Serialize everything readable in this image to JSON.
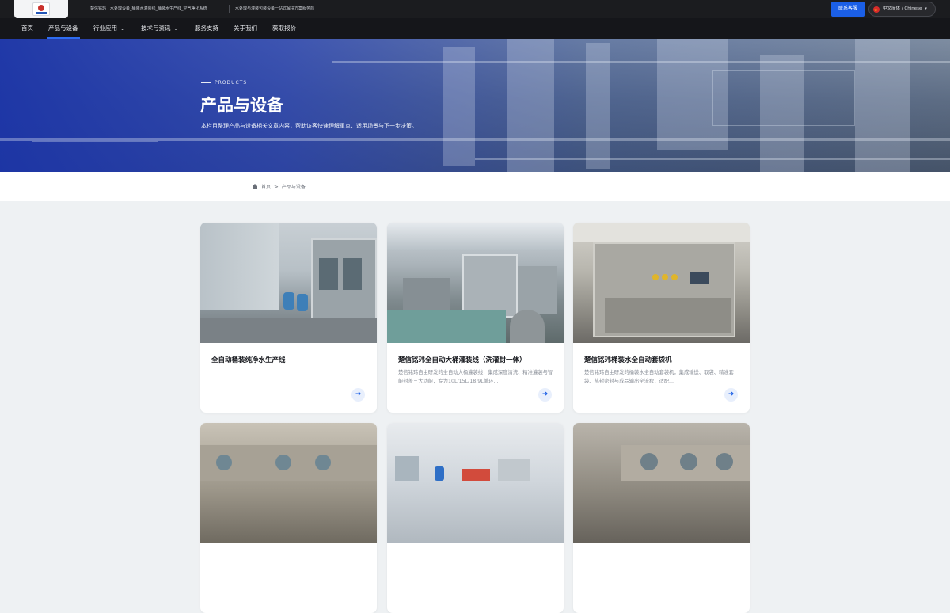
{
  "topbar": {
    "tagline_left": "楚信铭玮｜水处理设备_桶装水灌装线_桶装水生产线_空气净化系统",
    "tagline_right": "水处理与灌装包装设备一站式解决方案服务商",
    "contact_label": "联系客服",
    "language_label": "中文简体 / Chinese"
  },
  "nav": {
    "items": [
      {
        "label": "首页"
      },
      {
        "label": "产品与设备"
      },
      {
        "label": "行业应用"
      },
      {
        "label": "技术与资讯"
      },
      {
        "label": "服务支持"
      },
      {
        "label": "关于我们"
      },
      {
        "label": "获取报价"
      }
    ]
  },
  "hero": {
    "kicker": "PRODUCTS",
    "title": "产品与设备",
    "description": "本栏目整理产品与设备相关文章内容，帮助访客快速理解重点、适用场景与下一步决策。"
  },
  "breadcrumb": {
    "home": "首页",
    "separator": ">",
    "current": "产品与设备"
  },
  "products": [
    {
      "title": "全自动桶装纯净水生产线",
      "desc": ""
    },
    {
      "title": "楚信铭玮全自动大桶灌装线（洗灌封一体）",
      "desc": "楚信铭玮自主研发的全自动大桶灌装线，集成深度清洗、精准灌装与智能封盖三大功能，专为10L/15L/18.9L循环..."
    },
    {
      "title": "楚信铭玮桶装水全自动套袋机",
      "desc": "楚信铭玮自主研发的桶装水全自动套袋机，集成输送、取袋、精准套袋、热封密封与成品输出全流程，适配..."
    },
    {
      "title": "",
      "desc": ""
    },
    {
      "title": "",
      "desc": ""
    },
    {
      "title": "",
      "desc": ""
    }
  ],
  "colors": {
    "accent": "#1b5fe6",
    "topbar_bg": "#1b1c1f",
    "nav_bg": "#15161a",
    "page_bg": "#eef1f3"
  }
}
